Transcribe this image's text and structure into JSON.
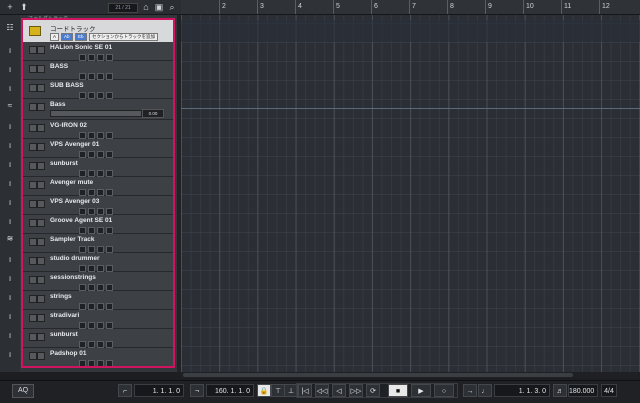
{
  "toolbar": {
    "add_track": "+",
    "add_folder": "⬆",
    "track_counter": "21 / 21",
    "home": "⌂",
    "view": "▣",
    "search": "⌕"
  },
  "folder_label": "フォルダトラック",
  "chord_track": {
    "name": "コードトラック",
    "btn_a": "A",
    "btn_b": "Ab",
    "btn_c": "Eb",
    "btn_follow": "セクションからトラックを追加"
  },
  "tracks": [
    {
      "name": "HALion Sonic SE 01"
    },
    {
      "name": "BASS"
    },
    {
      "name": "SUB BASS"
    },
    {
      "name": "Bass",
      "volume": "0.00"
    },
    {
      "name": "VG-IRON 02"
    },
    {
      "name": "VPS Avenger 01"
    },
    {
      "name": "sunburst"
    },
    {
      "name": "Avenger mute"
    },
    {
      "name": "VPS Avenger 03"
    },
    {
      "name": "Groove Agent SE 01"
    },
    {
      "name": "Sampler Track"
    },
    {
      "name": "studio drummer"
    },
    {
      "name": "sessionstrings"
    },
    {
      "name": "strings"
    },
    {
      "name": "stradivari"
    },
    {
      "name": "sunburst"
    },
    {
      "name": "Padshop 01"
    }
  ],
  "ruler": {
    "bars": [
      "2",
      "3",
      "4",
      "5",
      "6",
      "7",
      "8",
      "9",
      "10",
      "11",
      "12"
    ]
  },
  "transport": {
    "aq_label": "AQ",
    "left_locator": "1. 1. 1.   0",
    "right_locator": "160. 1. 1.   0",
    "position": "1. 1. 3.   0",
    "tempo": "180.000",
    "signature": "4/4",
    "btn_rewind_start": "|◁",
    "btn_prev": "◁◁",
    "btn_rewind": "◁",
    "btn_forward": "▷▷",
    "btn_cycle": "⟳",
    "btn_stop": "■",
    "btn_play": "▶",
    "btn_record": "○"
  },
  "colors": {
    "accent_border": "#d0145f",
    "chord_icon": "#d6b21c",
    "chord_btn_active": "#4a7bd0"
  }
}
